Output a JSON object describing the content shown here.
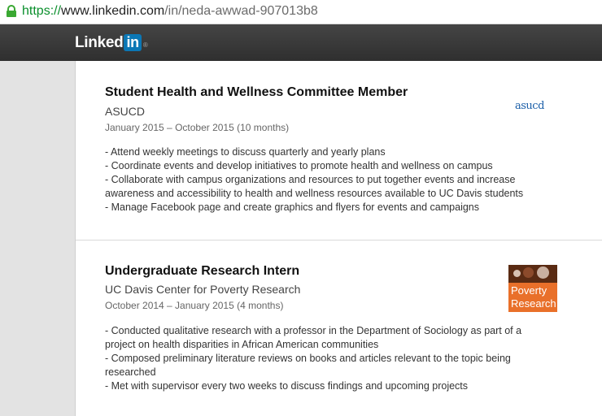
{
  "browser": {
    "url_scheme": "https://",
    "url_host": "www.linkedin.com",
    "url_path": "/in/neda-awwad-907013b8"
  },
  "header": {
    "logo_text": "Linked",
    "logo_in": "in",
    "logo_reg": "®"
  },
  "experience": [
    {
      "title": "Student Health and Wellness Committee Member",
      "company": "ASUCD",
      "dates": "January 2015 – October 2015 (10 months)",
      "logo_text": "asucd",
      "description": [
        "- Attend weekly meetings to discuss quarterly and yearly plans",
        "- Coordinate events and develop initiatives to promote health and wellness on campus",
        "- Collaborate with campus organizations and resources to put together events and increase awareness and accessibility to health and wellness resources available to UC Davis students",
        "- Manage Facebook page and create graphics and flyers for events and campaigns"
      ]
    },
    {
      "title": "Undergraduate Research Intern",
      "company": "UC Davis Center for Poverty Research",
      "dates": "October 2014 – January 2015 (4 months)",
      "logo_line1": "Poverty",
      "logo_line2": "Research",
      "description": [
        "- Conducted qualitative research with a professor in the Department of Sociology as part of a project on health disparities in African American communities",
        "- Composed preliminary literature reviews on books and articles relevant to the topic being researched",
        "- Met with supervisor every two weeks to discuss findings and upcoming projects"
      ]
    }
  ]
}
